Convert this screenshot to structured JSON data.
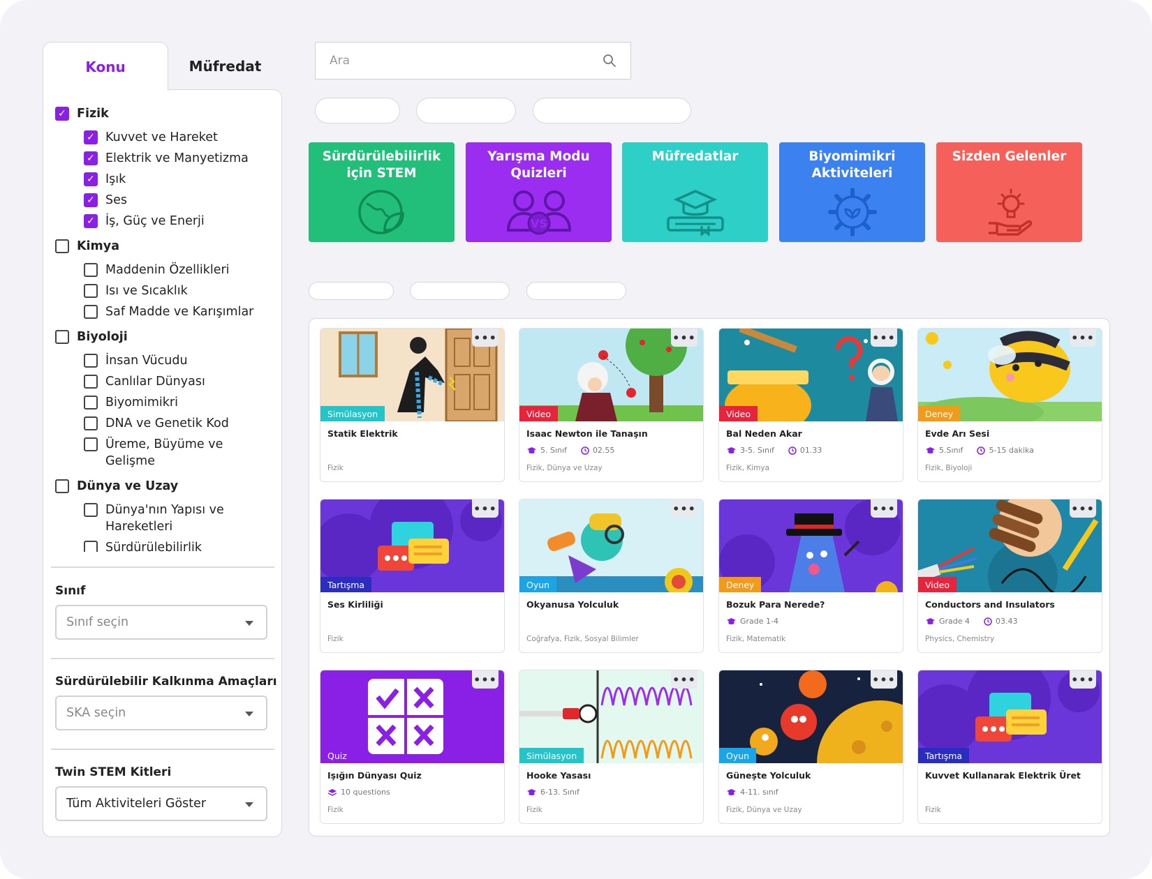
{
  "tabs": {
    "active": "Konu",
    "inactive": "Müfredat"
  },
  "topics": [
    {
      "label": "Fizik",
      "checked": true,
      "children": [
        {
          "label": "Kuvvet ve Hareket",
          "checked": true
        },
        {
          "label": "Elektrik ve Manyetizma",
          "checked": true
        },
        {
          "label": "Işık",
          "checked": true
        },
        {
          "label": "Ses",
          "checked": true
        },
        {
          "label": "İş, Güç ve Enerji",
          "checked": true
        }
      ]
    },
    {
      "label": "Kimya",
      "checked": false,
      "children": [
        {
          "label": "Maddenin Özellikleri",
          "checked": false
        },
        {
          "label": "Isı ve Sıcaklık",
          "checked": false
        },
        {
          "label": "Saf Madde ve Karışımlar",
          "checked": false
        }
      ]
    },
    {
      "label": "Biyoloji",
      "checked": false,
      "children": [
        {
          "label": "İnsan Vücudu",
          "checked": false
        },
        {
          "label": "Canlılar Dünyası",
          "checked": false
        },
        {
          "label": "Biyomimikri",
          "checked": false
        },
        {
          "label": "DNA ve Genetik Kod",
          "checked": false
        },
        {
          "label": "Üreme, Büyüme ve Gelişme",
          "checked": false
        }
      ]
    },
    {
      "label": "Dünya ve Uzay",
      "checked": false,
      "children": [
        {
          "label": "Dünya'nın Yapısı ve Hareketleri",
          "checked": false
        },
        {
          "label": "Sürdürülebilirlik Okuryazarlığı",
          "checked": false
        }
      ]
    }
  ],
  "filters": {
    "grade_label": "Sınıf",
    "grade_placeholder": "Sınıf seçin",
    "sdg_label": "Sürdürülebilir Kalkınma Amaçları",
    "sdg_placeholder": "SKA seçin",
    "kits_label": "Twin STEM Kitleri",
    "kits_value": "Tüm Aktiviteleri Göster"
  },
  "search": {
    "placeholder": "Ara"
  },
  "tiles": [
    {
      "label": "Sürdürülebilirlik için STEM",
      "color": "#22bf7b",
      "icon": "globe-leaf-icon"
    },
    {
      "label": "Yarışma Modu Quizleri",
      "color": "#9b2df0",
      "icon": "vs-users-icon"
    },
    {
      "label": "Müfredatlar",
      "color": "#2ecfc6",
      "icon": "graduation-book-icon"
    },
    {
      "label": "Biyomimikri Aktiviteleri",
      "color": "#3b82f0",
      "icon": "gear-leaf-icon"
    },
    {
      "label": "Sizden Gelenler",
      "color": "#f5605a",
      "icon": "bulb-hand-icon"
    }
  ],
  "cards": [
    {
      "badge": "Simülasyon",
      "badge_color": "#24c4c8",
      "title": "Statik Elektrik",
      "grade": "",
      "duration": "",
      "tags": "Fizik",
      "thumb": "static"
    },
    {
      "badge": "Video",
      "badge_color": "#e8243c",
      "title": "Isaac Newton ile Tanaşın",
      "grade": "5. Sınıf",
      "duration": "02.55",
      "tags": "Fizik, Dünya ve Uzay",
      "thumb": "newton"
    },
    {
      "badge": "Video",
      "badge_color": "#e8243c",
      "title": "Bal Neden Akar",
      "grade": "3-5. Sınıf",
      "duration": "01.33",
      "tags": "Fizik, Kimya",
      "thumb": "honey"
    },
    {
      "badge": "Deney",
      "badge_color": "#f29a1a",
      "title": "Evde Arı Sesi",
      "grade": "5.Sınıf",
      "duration": "5-15 dakika",
      "tags": "Fizik, Biyoloji",
      "thumb": "bee"
    },
    {
      "badge": "Tartışma",
      "badge_color": "#2a2dbf",
      "title": "Ses Kirliliği",
      "grade": "",
      "duration": "",
      "tags": "Fizik",
      "thumb": "chat"
    },
    {
      "badge": "Oyun",
      "badge_color": "#1aa6e6",
      "title": "Okyanusa Yolculuk",
      "grade": "",
      "duration": "",
      "tags": "Coğrafya, Fizik, Sosyal Bilimler",
      "thumb": "ocean"
    },
    {
      "badge": "Deney",
      "badge_color": "#f29a1a",
      "title": "Bozuk Para Nerede?",
      "grade": "Grade 1-4",
      "duration": "",
      "tags": "Fizik, Matematik",
      "thumb": "magic"
    },
    {
      "badge": "Video",
      "badge_color": "#e8243c",
      "title": "Conductors and Insulators",
      "grade": "Grade 4",
      "duration": "03.43",
      "tags": "Physics, Chemistry",
      "thumb": "wires"
    },
    {
      "badge": "Quiz",
      "badge_color": "#8a1fe6",
      "title": "Işığın Dünyası Quiz",
      "grade": "10 questions",
      "duration": "",
      "tags": "Fizik",
      "thumb": "quiz",
      "meta_icon": "stack"
    },
    {
      "badge": "Simülasyon",
      "badge_color": "#24c4c8",
      "title": "Hooke Yasası",
      "grade": "6-13. Sınıf",
      "duration": "",
      "tags": "Fizik",
      "thumb": "spring"
    },
    {
      "badge": "Oyun",
      "badge_color": "#1aa6e6",
      "title": "Güneşte Yolculuk",
      "grade": "4-11. sınıf",
      "duration": "",
      "tags": "Fizik, Dünya ve Uzay",
      "thumb": "sun"
    },
    {
      "badge": "Tartışma",
      "badge_color": "#2a2dbf",
      "title": "Kuvvet Kullanarak Elektrik Üret",
      "grade": "",
      "duration": "",
      "tags": "Fizik",
      "thumb": "chat"
    }
  ],
  "colors": {
    "accent": "#8a1fe6",
    "border": "#d6d6de",
    "bg": "#f3f2f7"
  }
}
